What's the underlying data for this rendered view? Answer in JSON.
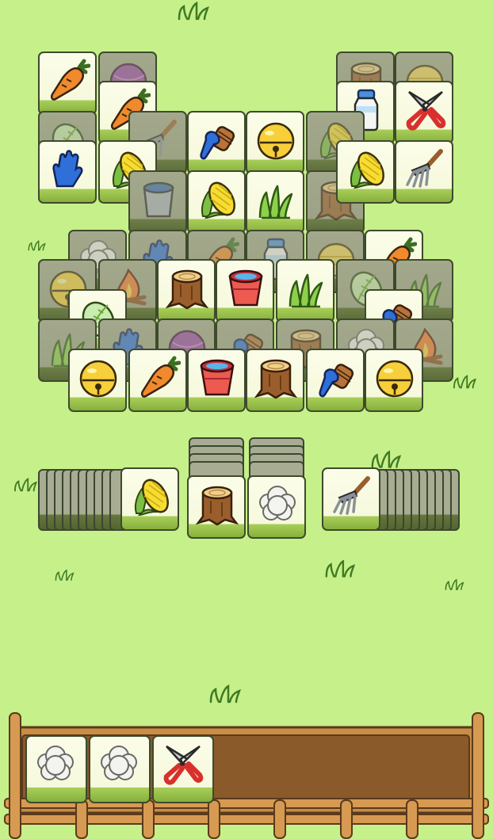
{
  "game": {
    "board_tiles": [
      {
        "icon": "purple-yarn-icon",
        "state": "covered"
      },
      {
        "icon": "tree-stump-icon",
        "state": "covered"
      },
      {
        "icon": "hay-bale-icon",
        "state": "covered"
      },
      {
        "icon": "carrot-icon",
        "state": "free"
      },
      {
        "icon": "carrot-icon",
        "state": "free"
      },
      {
        "icon": "milk-bottle-icon",
        "state": "free"
      },
      {
        "icon": "garden-shears-icon",
        "state": "free"
      },
      {
        "icon": "cabbage-icon",
        "state": "covered"
      },
      {
        "icon": "pitchfork-icon",
        "state": "covered"
      },
      {
        "icon": "blue-brush-icon",
        "state": "free"
      },
      {
        "icon": "golden-bell-icon",
        "state": "free"
      },
      {
        "icon": "corn-icon",
        "state": "covered"
      },
      {
        "icon": "blue-glove-icon",
        "state": "free"
      },
      {
        "icon": "corn-icon",
        "state": "free"
      },
      {
        "icon": "metal-bucket-icon",
        "state": "covered"
      },
      {
        "icon": "corn-icon",
        "state": "free"
      },
      {
        "icon": "grass-icon",
        "state": "free"
      },
      {
        "icon": "tree-stump-icon",
        "state": "covered"
      },
      {
        "icon": "corn-icon",
        "state": "free"
      },
      {
        "icon": "pitchfork-icon",
        "state": "free"
      },
      {
        "icon": "wool-ball-icon",
        "state": "covered"
      },
      {
        "icon": "blue-glove-icon",
        "state": "covered"
      },
      {
        "icon": "carrot-icon",
        "state": "covered"
      },
      {
        "icon": "milk-bottle-icon",
        "state": "covered"
      },
      {
        "icon": "hay-bale-icon",
        "state": "covered"
      },
      {
        "icon": "carrot-icon",
        "state": "free"
      },
      {
        "icon": "golden-bell-icon",
        "state": "covered"
      },
      {
        "icon": "campfire-icon",
        "state": "covered"
      },
      {
        "icon": "tree-stump-icon",
        "state": "free"
      },
      {
        "icon": "red-bucket-icon",
        "state": "free"
      },
      {
        "icon": "grass-icon",
        "state": "free"
      },
      {
        "icon": "cabbage-icon",
        "state": "covered"
      },
      {
        "icon": "grass-icon",
        "state": "covered"
      },
      {
        "icon": "cabbage-icon",
        "state": "free"
      },
      {
        "icon": "blue-brush-icon",
        "state": "free"
      },
      {
        "icon": "grass-icon",
        "state": "covered"
      },
      {
        "icon": "blue-glove-icon",
        "state": "covered"
      },
      {
        "icon": "purple-yarn-icon",
        "state": "covered"
      },
      {
        "icon": "blue-brush-icon",
        "state": "covered"
      },
      {
        "icon": "tree-stump-icon",
        "state": "covered"
      },
      {
        "icon": "wool-ball-icon",
        "state": "covered"
      },
      {
        "icon": "campfire-icon",
        "state": "covered"
      },
      {
        "icon": "golden-bell-icon",
        "state": "free"
      },
      {
        "icon": "carrot-icon",
        "state": "free"
      },
      {
        "icon": "red-bucket-icon",
        "state": "free"
      },
      {
        "icon": "tree-stump-icon",
        "state": "free"
      },
      {
        "icon": "blue-brush-icon",
        "state": "free"
      },
      {
        "icon": "golden-bell-icon",
        "state": "free"
      }
    ],
    "stacks": {
      "left": {
        "top_icon": "corn-icon",
        "hidden_count": 10
      },
      "center_left": {
        "top_icon": "tree-stump-icon",
        "hidden_count": 4
      },
      "center_right": {
        "top_icon": "wool-ball-icon",
        "hidden_count": 4
      },
      "right": {
        "top_icon": "pitchfork-icon",
        "hidden_count": 10
      }
    },
    "tray": {
      "capacity": 7,
      "slots": [
        "wool-ball-icon",
        "wool-ball-icon",
        "garden-shears-icon"
      ]
    },
    "colors": {
      "background": "#c6f08a",
      "tile_face": "#f6f9dc",
      "tile_base": "#8fbb45",
      "tray_wood": "#c98d45",
      "tray_soil": "#8a5a2b"
    }
  }
}
